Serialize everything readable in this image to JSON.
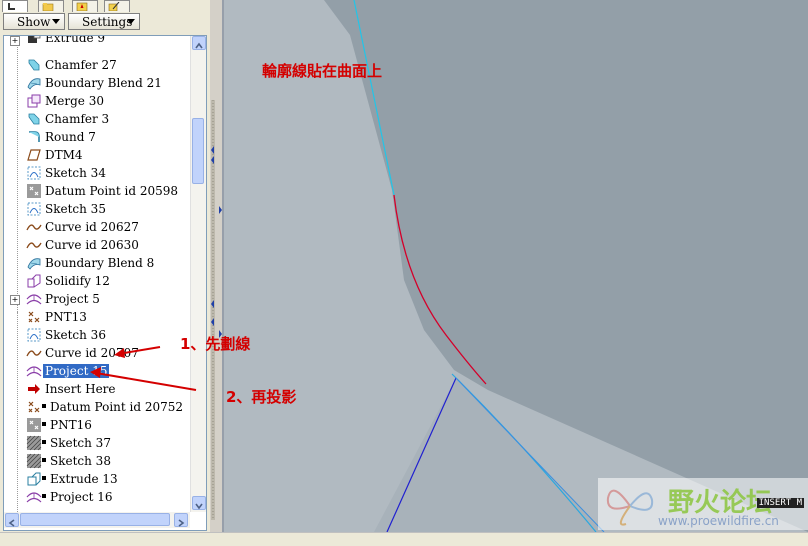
{
  "toolbar": {
    "show_label": "Show",
    "settings_label": "Settings"
  },
  "tree": {
    "partial_top_label": "Extrude 9",
    "items": [
      {
        "label": "Chamfer 27",
        "icon": "chamfer-icon"
      },
      {
        "label": "Boundary Blend 21",
        "icon": "boundary-blend-icon"
      },
      {
        "label": "Merge 30",
        "icon": "merge-icon"
      },
      {
        "label": "Chamfer 3",
        "icon": "chamfer-icon"
      },
      {
        "label": "Round 7",
        "icon": "round-icon"
      },
      {
        "label": "DTM4",
        "icon": "datum-plane-icon"
      },
      {
        "label": "Sketch 34",
        "icon": "sketch-icon"
      },
      {
        "label": "Datum Point id 20598",
        "icon": "datum-point-icon"
      },
      {
        "label": "Sketch 35",
        "icon": "sketch-icon"
      },
      {
        "label": "Curve id 20627",
        "icon": "curve-icon"
      },
      {
        "label": "Curve id 20630",
        "icon": "curve-icon"
      },
      {
        "label": "Boundary Blend 8",
        "icon": "boundary-blend-icon"
      },
      {
        "label": "Solidify 12",
        "icon": "solidify-icon"
      },
      {
        "label": "Project 5",
        "icon": "project-icon"
      },
      {
        "label": "PNT13",
        "icon": "point-icon"
      },
      {
        "label": "Sketch 36",
        "icon": "sketch-icon"
      },
      {
        "label": "Curve id 20707",
        "icon": "curve-icon"
      },
      {
        "label": "Project 15",
        "icon": "project-icon"
      },
      {
        "label": "Insert Here",
        "icon": "insert-here-icon"
      },
      {
        "label": "Datum Point id 20752",
        "icon": "point-icon"
      },
      {
        "label": "PNT16",
        "icon": "datum-point-icon"
      },
      {
        "label": "Sketch 37",
        "icon": "sketch-hatched-icon"
      },
      {
        "label": "Sketch 38",
        "icon": "sketch-hatched-icon"
      },
      {
        "label": "Extrude 13",
        "icon": "extrude-icon"
      },
      {
        "label": "Project 16",
        "icon": "project-icon"
      }
    ]
  },
  "annotations": {
    "top_note": "輪廓線貼在曲面上",
    "step1": "1、先劃線",
    "step2": "2、再投影"
  },
  "status": {
    "mode": "INSERT M"
  },
  "watermark": {
    "title": "野火论坛",
    "url": "www.proewildfire.cn"
  },
  "colors": {
    "selection": "#316ac5",
    "annotation_red": "#d40000",
    "surface_light": "#a9b3bb",
    "surface_dark": "#8f9aa2"
  }
}
